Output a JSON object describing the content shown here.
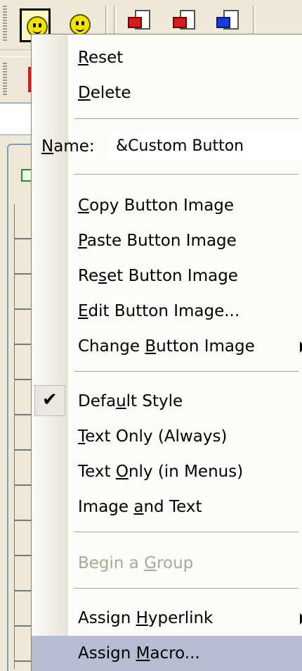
{
  "menu": {
    "items_top": [
      {
        "prefix": "",
        "accel": "R",
        "suffix": "eset"
      },
      {
        "prefix": "",
        "accel": "D",
        "suffix": "elete"
      }
    ],
    "name_field": {
      "label_accel": "N",
      "label_suffix": "ame:",
      "value": "&Custom Button"
    },
    "image_items": [
      {
        "prefix": "",
        "accel": "C",
        "suffix": "opy Button Image"
      },
      {
        "prefix": "",
        "accel": "P",
        "suffix": "aste Button Image"
      },
      {
        "prefix": "Re",
        "accel": "s",
        "suffix": "et Button Image"
      },
      {
        "prefix": "",
        "accel": "E",
        "suffix": "dit Button Image..."
      },
      {
        "prefix": "Change ",
        "accel": "B",
        "suffix": "utton Image"
      }
    ],
    "style_items": [
      {
        "prefix": "Defa",
        "accel": "u",
        "suffix": "lt Style"
      },
      {
        "prefix": "",
        "accel": "T",
        "suffix": "ext Only (Always)"
      },
      {
        "prefix": "Text ",
        "accel": "O",
        "suffix": "nly (in Menus)"
      },
      {
        "prefix": "Image ",
        "accel": "a",
        "suffix": "nd Text"
      }
    ],
    "group_item": {
      "prefix": "Begin a ",
      "accel": "G",
      "suffix": "roup"
    },
    "assign_items": [
      {
        "prefix": "Assign ",
        "accel": "H",
        "suffix": "yperlink"
      },
      {
        "prefix": "Assign ",
        "accel": "M",
        "suffix": "acro..."
      }
    ],
    "checkmark": "✔"
  }
}
